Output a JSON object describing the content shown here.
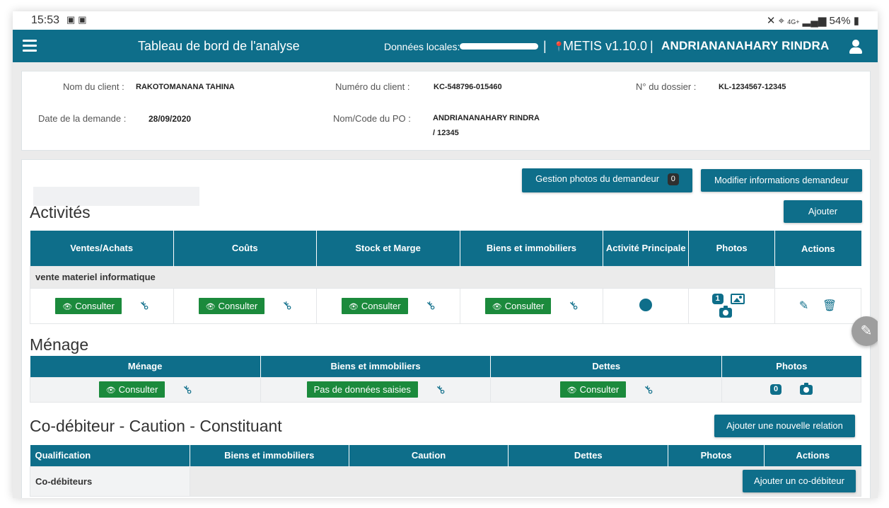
{
  "status_bar": {
    "time": "15:53",
    "left_icons": [
      "image-icon",
      "photo-icon"
    ],
    "right_text": "54%",
    "network": "4G+"
  },
  "app_bar": {
    "title": "Tableau de bord de l'analyse",
    "local_data_label": "Données locales:",
    "separator": "|",
    "version": "METIS v1.10.0",
    "user_name": "ANDRIANANAHARY RINDRA"
  },
  "client_info": {
    "client_name_label": "Nom du client :",
    "client_name": "RAKOTOMANANA TAHINA",
    "client_number_label": "Numéro du client :",
    "client_number": "KC-548796-015460",
    "file_number_label": "N° du dossier :",
    "file_number": "KL-1234567-12345",
    "request_date_label": "Date de la demande :",
    "request_date": "28/09/2020",
    "po_label": "Nom/Code du PO :",
    "po_name": "ANDRIANANAHARY RINDRA",
    "po_code": "/ 12345"
  },
  "toolbar": {
    "photos_button": "Gestion photos du demandeur",
    "photos_count": "0",
    "modify_button": "Modifier informations demandeur"
  },
  "activities": {
    "title": "Activités",
    "add_button": "Ajouter",
    "headers": [
      "Ventes/Achats",
      "Coûts",
      "Stock et Marge",
      "Biens et immobiliers",
      "Activité Principale",
      "Photos",
      "Actions"
    ],
    "group_name": "vente materiel informatique",
    "consult_label": "Consulter",
    "photos_count": "1"
  },
  "household": {
    "title": "Ménage",
    "headers": [
      "Ménage",
      "Biens et immobiliers",
      "Dettes",
      "Photos"
    ],
    "consult_label": "Consulter",
    "no_data_label": "Pas de données saisies",
    "photos_count": "0"
  },
  "codebtor": {
    "title": "Co-débiteur - Caution - Constituant",
    "add_relation_button": "Ajouter une nouvelle relation",
    "headers": [
      "Qualification",
      "Biens et immobiliers",
      "Caution",
      "Dettes",
      "Photos",
      "Actions"
    ],
    "row_label": "Co-débiteurs",
    "add_codebtor_button": "Ajouter un co-débiteur"
  },
  "colors": {
    "primary": "#0e6e8a",
    "success": "#1b8a3c",
    "fab": "#9e9e9e"
  }
}
